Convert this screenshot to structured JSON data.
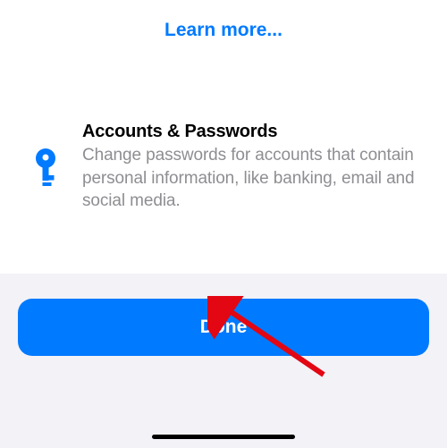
{
  "top": {
    "learn_more": "Learn more..."
  },
  "section": {
    "title": "Accounts & Passwords",
    "description": "Change passwords for accounts that contain personal information, like banking, email and social media."
  },
  "button": {
    "done": "Done"
  },
  "colors": {
    "accent": "#007AFF",
    "secondary_text": "#8E8E93",
    "footer_bg": "#F2F2F7"
  }
}
